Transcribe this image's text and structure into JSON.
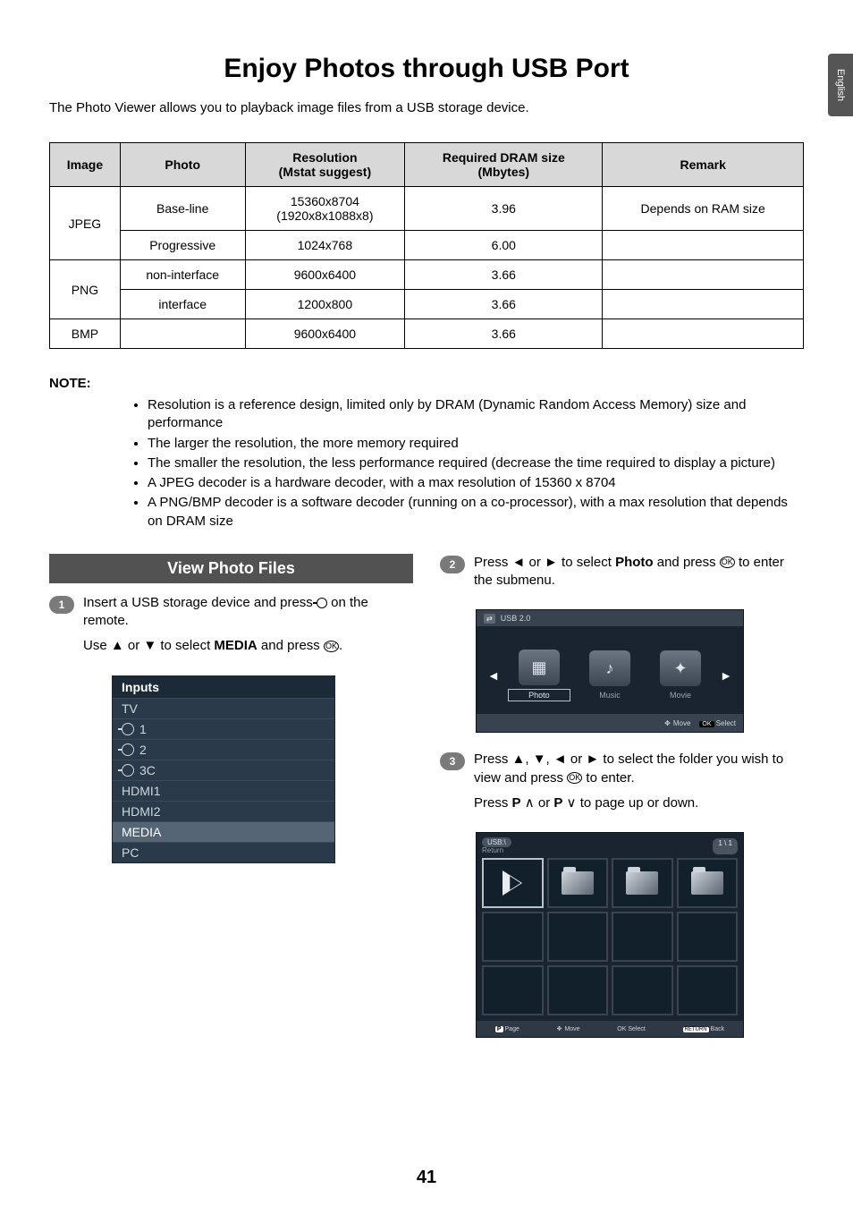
{
  "side_tab": "English",
  "title": "Enjoy Photos through USB Port",
  "intro": "The Photo Viewer allows you to playback image files from a USB storage device.",
  "table": {
    "headers": [
      "Image",
      "Photo",
      "Resolution\n(Mstat suggest)",
      "Required DRAM size\n(Mbytes)",
      "Remark"
    ],
    "rows": [
      [
        "JPEG",
        "Base-line",
        "15360x8704\n(1920x8x1088x8)",
        "3.96",
        "Depends on RAM size"
      ],
      [
        "",
        "Progressive",
        "1024x768",
        "6.00",
        ""
      ],
      [
        "PNG",
        "non-interface",
        "9600x6400",
        "3.66",
        ""
      ],
      [
        "",
        "interface",
        "1200x800",
        "3.66",
        ""
      ],
      [
        "BMP",
        "",
        "9600x6400",
        "3.66",
        ""
      ]
    ]
  },
  "note_label": "NOTE:",
  "notes": [
    "Resolution is a reference design, limited only by DRAM (Dynamic Random Access Memory) size and performance",
    "The larger the resolution, the more memory required",
    "The smaller the resolution, the less performance required (decrease the time required to display a picture)",
    "A JPEG decoder is a hardware decoder, with a max resolution of 15360 x 8704",
    "A PNG/BMP decoder is a software decoder (running on a co-processor), with a max resolution that depends on DRAM size"
  ],
  "section_heading": "View Photo Files",
  "steps": {
    "s1a": "Insert a USB storage device and  press ",
    "s1b": " on the remote.",
    "s1c_pre": "Use ▲ or ▼ to select ",
    "s1c_bold": "MEDIA",
    "s1c_post": " and press ",
    "s1c_end": ".",
    "s2_pre": "Press ◄ or ► to select ",
    "s2_bold": "Photo",
    "s2_post": " and press ",
    "s2_end": " to enter the submenu.",
    "s3a": "Press ▲, ▼, ◄ or ► to select the folder you wish to view and press ",
    "s3a_end": " to enter.",
    "s3b_pre": "Press ",
    "s3b_p1": "P",
    "s3b_mid1": " ∧ or ",
    "s3b_p2": "P",
    "s3b_mid2": " ∨ to page up or down."
  },
  "inputs_menu": {
    "header": "Inputs",
    "items": [
      "TV",
      "1",
      "2",
      "3C",
      "HDMI1",
      "HDMI2",
      "MEDIA",
      "PC"
    ],
    "selected_index": 6
  },
  "media_screen": {
    "usb_label": "USB 2.0",
    "items": [
      {
        "label": "Photo",
        "glyph": "▦",
        "selected": true
      },
      {
        "label": "Music",
        "glyph": "♪",
        "selected": false
      },
      {
        "label": "Movie",
        "glyph": "✦",
        "selected": false
      }
    ],
    "legend_move": "Move",
    "legend_select": "Select",
    "legend_ok": "OK"
  },
  "grid_screen": {
    "breadcrumb": "USB:\\",
    "return": "Return",
    "page_indicator": "1 \\ 1",
    "legend": {
      "page": "Page",
      "move": "Move",
      "select": "Select",
      "back": "Back",
      "p": "P",
      "ok": "OK",
      "return": "RETURN"
    }
  },
  "page_number": "41"
}
